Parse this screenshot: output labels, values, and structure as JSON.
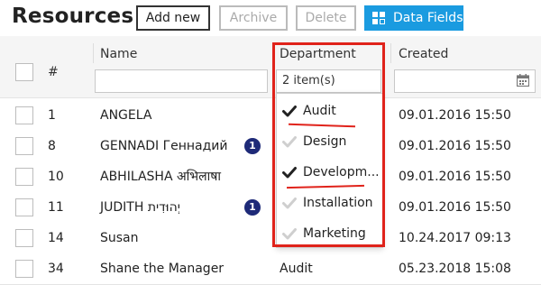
{
  "page": {
    "title": "Resources"
  },
  "toolbar": {
    "add_label": "Add new",
    "archive_label": "Archive",
    "delete_label": "Delete",
    "data_fields_label": "Data Fields"
  },
  "columns": {
    "number": "#",
    "name": "Name",
    "department": "Department",
    "created": "Created"
  },
  "filters": {
    "department_value": "2 item(s)"
  },
  "rows": [
    {
      "num": "1",
      "name": "ANGELA",
      "badge": "",
      "department": "",
      "created": "09.01.2016 15:50"
    },
    {
      "num": "8",
      "name": "GENNADI Геннадий",
      "badge": "1",
      "department": "",
      "created": "09.01.2016 15:50"
    },
    {
      "num": "10",
      "name": "ABHILASHA अभिलाषा",
      "badge": "",
      "department": "",
      "created": "09.01.2016 15:50"
    },
    {
      "num": "11",
      "name": "JUDITH יְהוּדִית",
      "badge": "1",
      "department": "",
      "created": "09.01.2016 15:50"
    },
    {
      "num": "14",
      "name": "Susan",
      "badge": "",
      "department": "",
      "created": "10.24.2017 09:13"
    },
    {
      "num": "34",
      "name": "Shane the Manager",
      "badge": "",
      "department": "Audit",
      "created": "05.23.2018 15:08"
    }
  ],
  "dropdown": {
    "options": [
      {
        "label": "Audit",
        "checked": true
      },
      {
        "label": "Design",
        "checked": false
      },
      {
        "label": "Developm...",
        "checked": true
      },
      {
        "label": "Installation",
        "checked": false
      },
      {
        "label": "Marketing",
        "checked": false
      }
    ]
  },
  "colors": {
    "accent": "#1a9be0",
    "highlight": "#e0231b",
    "badge": "#1e2a78",
    "check_on": "#222222",
    "check_off": "#cfcfcf"
  }
}
